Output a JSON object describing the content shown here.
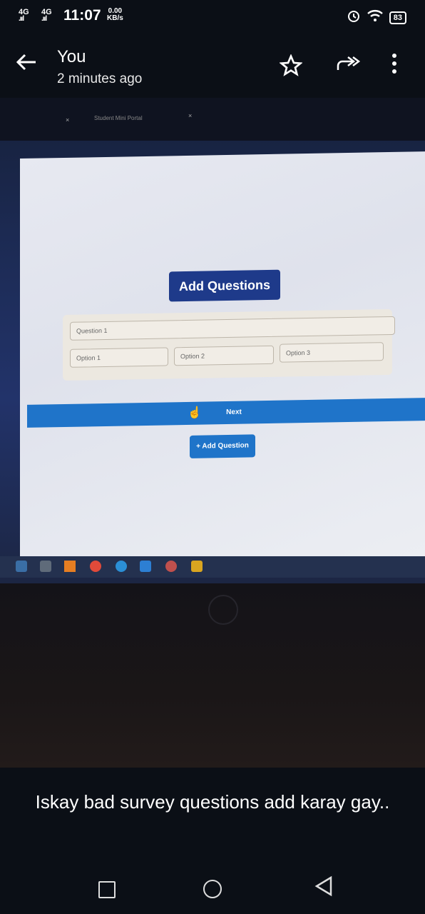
{
  "status": {
    "network1": "4G",
    "network2": "4G",
    "signal_bars": ".ııl",
    "time": "11:07",
    "speed_value": "0.00",
    "speed_unit": "KB/s",
    "battery": "83"
  },
  "header": {
    "title": "You",
    "subtitle": "2 minutes ago"
  },
  "photo": {
    "tab_title": "Student Mini Portal",
    "tab_close": "×",
    "add_questions_title": "Add Questions",
    "question_placeholder": "Question 1",
    "option1": "Option 1",
    "option2": "Option 2",
    "option3": "Option 3",
    "next_label": "Next",
    "add_question_label": "+ Add Question"
  },
  "caption": "Iskay bad survey questions add karay gay..",
  "colors": {
    "button_blue": "#1f74c9",
    "title_blue": "#1e3a8a"
  }
}
